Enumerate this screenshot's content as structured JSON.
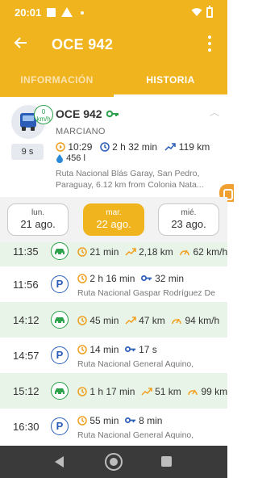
{
  "status_bar": {
    "time": "20:01"
  },
  "app_bar": {
    "title": "OCE 942"
  },
  "tabs": [
    {
      "label": "INFORMACIÓN"
    },
    {
      "label": "HISTORIA"
    }
  ],
  "vehicle": {
    "plate": "OCE 942",
    "driver": "MARCIANO",
    "speed_value": "0",
    "speed_unit": "km/h",
    "last_update": "9 s",
    "start_time": "10:29",
    "duration": "2 h 32 min",
    "distance": "119 km",
    "fuel": "456 l",
    "address": "Ruta Nacional Blás Garay, San Pedro, Paraguay, 6.12 km from Colonia Nata..."
  },
  "days": [
    {
      "name": "lun.",
      "date": "21 ago."
    },
    {
      "name": "mar.",
      "date": "22 ago."
    },
    {
      "name": "mié.",
      "date": "23 ago."
    }
  ],
  "timeline": [
    {
      "time": "11:35",
      "kind": "trip",
      "duration": "21 min",
      "distance": "2,18 km",
      "avg_speed": "62 km/h"
    },
    {
      "time": "11:56",
      "kind": "stop",
      "duration": "2 h 16 min",
      "ignition": "32 min",
      "place": "Ruta Nacional Gaspar Rodríguez De"
    },
    {
      "time": "14:12",
      "kind": "trip",
      "duration": "45 min",
      "distance": "47 km",
      "avg_speed": "94 km/h"
    },
    {
      "time": "14:57",
      "kind": "stop",
      "duration": "14 min",
      "ignition": "17 s",
      "place": "Ruta Nacional General Aquino,"
    },
    {
      "time": "15:12",
      "kind": "trip",
      "duration": "1 h 17 min",
      "distance": "51 km",
      "avg_speed": "99 km/h"
    },
    {
      "time": "16:30",
      "kind": "stop",
      "duration": "55 min",
      "ignition": "8 min",
      "place": "Ruta Nacional General Aquino,"
    }
  ],
  "colors": {
    "accent": "#f0b41e",
    "trip_green": "#2aa14a",
    "stop_blue": "#2a5cb8",
    "trip_bg": "#e9f4e8"
  },
  "icons": {
    "back": "arrow-left-icon",
    "more": "more-vertical-icon",
    "truck": "truck-icon",
    "key": "key-icon",
    "clock": "clock-icon",
    "distance": "trend-icon",
    "fuel": "drop-icon",
    "parking": "parking-icon",
    "car": "car-icon",
    "speed": "speedometer-icon"
  }
}
